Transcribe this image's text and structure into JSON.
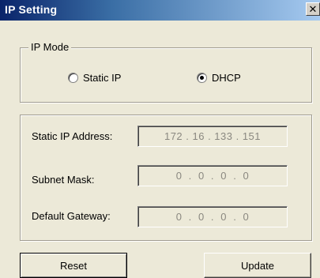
{
  "window": {
    "title": "IP Setting",
    "close_glyph": "✕",
    "close_icon": "close-icon"
  },
  "ip_mode": {
    "legend": "IP Mode",
    "options": [
      {
        "label": "Static IP",
        "checked": false
      },
      {
        "label": "DHCP",
        "checked": true
      }
    ]
  },
  "ip_settings": {
    "static_ip": {
      "label": "Static IP Address:",
      "value": "172 . 16 . 133 . 151"
    },
    "subnet_mask": {
      "label": "Subnet Mask:",
      "value": "0  .  0  .  0  .  0"
    },
    "default_gateway": {
      "label": "Default Gateway:",
      "value": "0  .  0  .  0  .  0"
    }
  },
  "buttons": {
    "reset": "Reset",
    "update": "Update"
  },
  "colors": {
    "titlebar_start": "#0a246a",
    "titlebar_end": "#a6caf0",
    "dialog_bg": "#ece9d8",
    "disabled_text": "#8a8880"
  }
}
